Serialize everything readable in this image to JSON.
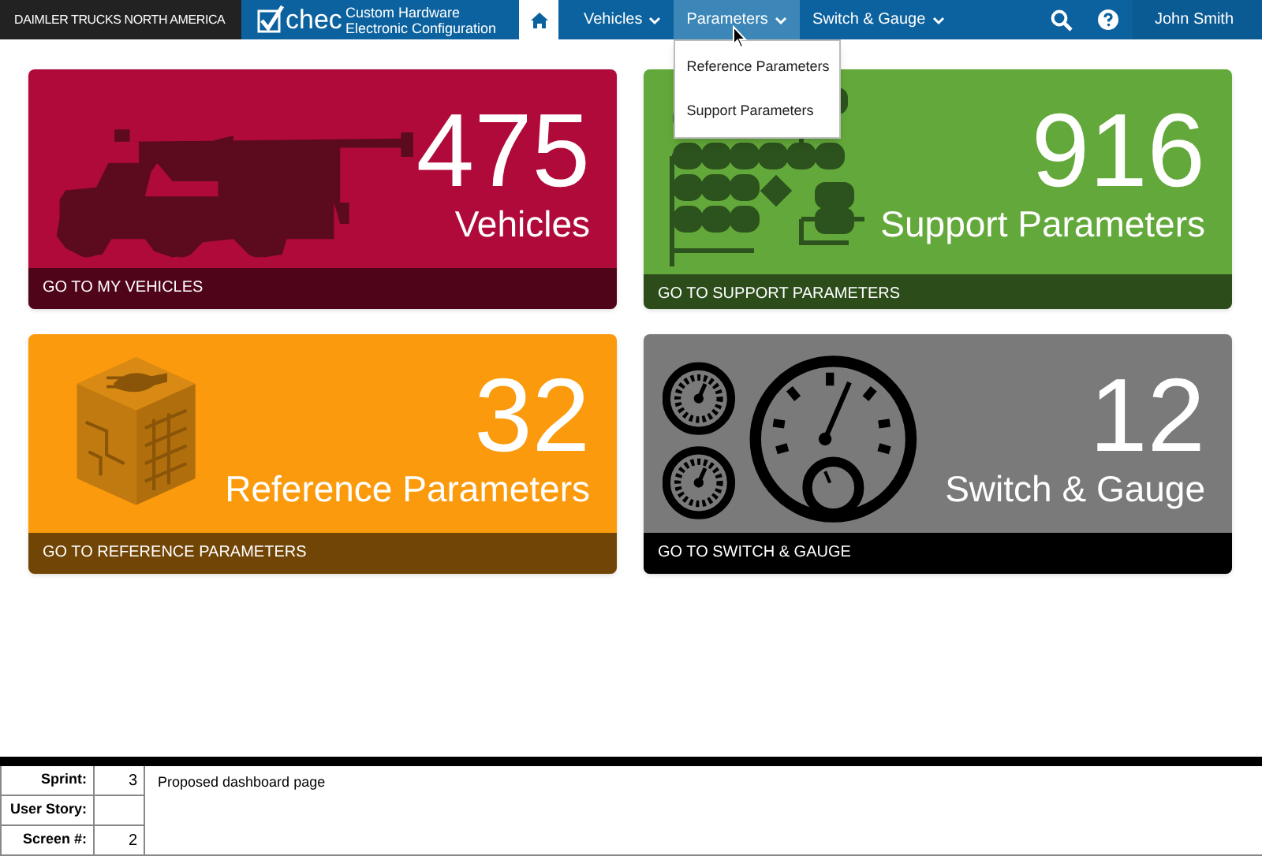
{
  "brand": "DAIMLER TRUCKS NORTH AMERICA",
  "app": {
    "logo": "chec",
    "title_line1": "Custom Hardware",
    "title_line2": "Electronic Configuration"
  },
  "nav": [
    {
      "kind": "home",
      "selected": true,
      "expanded": false
    },
    {
      "kind": "menu",
      "label": "Vehicles",
      "selected": false,
      "expanded": false
    },
    {
      "kind": "menu",
      "label": "Parameters",
      "selected": false,
      "expanded": true,
      "menu": [
        "Reference Parameters",
        "Support Parameters"
      ]
    },
    {
      "kind": "menu",
      "label": "Switch & Gauge",
      "selected": false,
      "expanded": false
    }
  ],
  "user": "John Smith",
  "cards": [
    {
      "kind": "truck",
      "count": "475",
      "label": "Vehicles",
      "link": "GO TO MY VEHICLES",
      "color": "#b00a3a"
    },
    {
      "kind": "flow",
      "count": "916",
      "label": "Support Parameters",
      "link": "GO TO SUPPORT PARAMETERS",
      "color": "#63a83a"
    },
    {
      "kind": "cube",
      "count": "32",
      "label": "Reference Parameters",
      "link": "GO TO REFERENCE PARAMETERS",
      "color": "#fb9a0c"
    },
    {
      "kind": "gauge",
      "count": "12",
      "label": "Switch & Gauge",
      "link": "GO TO SWITCH & GAUGE",
      "color": "#7a7a7b"
    }
  ],
  "footer": {
    "sprint_label": "Sprint:",
    "sprint": "3",
    "story_label": "User Story:",
    "screen_label": "Screen #:",
    "screen": "2",
    "note": "Proposed dashboard page"
  }
}
